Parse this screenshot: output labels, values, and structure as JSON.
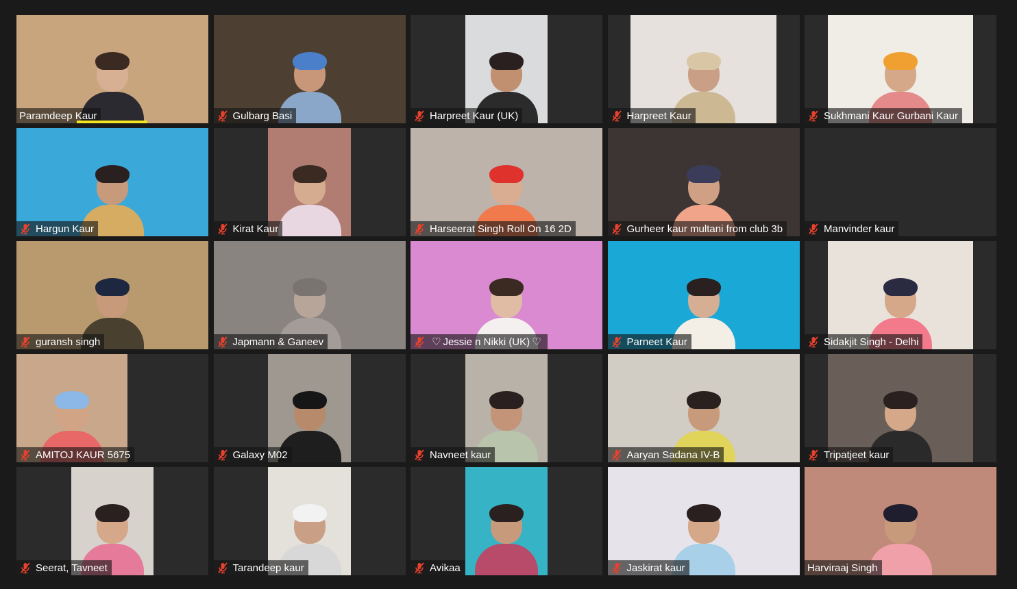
{
  "meeting": {
    "participants": [
      {
        "name": "Paramdeep Kaur",
        "muted": false,
        "speaking": true,
        "video_bg": "#c9a57d",
        "skin": "#d7b094",
        "wrap": "#3a2a22",
        "top": "#2b2a30"
      },
      {
        "name": "Gulbarg Basi",
        "muted": true,
        "speaking": false,
        "video_bg": "#4d4033",
        "skin": "#c8977a",
        "wrap": "#4b7fc9",
        "top": "#8aa6c8"
      },
      {
        "name": "Harpreet Kaur (UK)",
        "muted": true,
        "speaking": false,
        "video_bg": "#d9dbdc",
        "skin": "#c09070",
        "wrap": "#2a2020",
        "top": "#2b2b2b"
      },
      {
        "name": "Harpreet Kaur",
        "muted": true,
        "speaking": false,
        "video_bg": "#e6e1dc",
        "skin": "#c9a086",
        "wrap": "#d9c6a5",
        "top": "#cdb894"
      },
      {
        "name": "Sukhmani Kaur Gurbani Kaur",
        "muted": true,
        "speaking": false,
        "video_bg": "#f0ece6",
        "skin": "#d4a888",
        "wrap": "#f0a030",
        "top": "#e58a8a"
      },
      {
        "name": "Hargun Kaur",
        "muted": true,
        "speaking": false,
        "video_bg": "#3aa8d8",
        "skin": "#c89a7c",
        "wrap": "#2a2020",
        "top": "#d6ac62"
      },
      {
        "name": "Kirat Kaur",
        "muted": true,
        "speaking": false,
        "video_bg": "#b17d72",
        "skin": "#d6ac90",
        "wrap": "#3a2a22",
        "top": "#e8d6e0"
      },
      {
        "name": "Harseerat Singh Roll On 16 2D",
        "muted": true,
        "speaking": false,
        "video_bg": "#bdb3ab",
        "skin": "#d8ad92",
        "wrap": "#e0322c",
        "top": "#f07a4c"
      },
      {
        "name": "Gurheer kaur multani from club 3b",
        "muted": true,
        "speaking": false,
        "video_bg": "#3d3533",
        "skin": "#d0a085",
        "wrap": "#3a3c5a",
        "top": "#f0a48a"
      },
      {
        "name": "Manvinder kaur",
        "muted": true,
        "speaking": false,
        "video_bg": "#2b2b2b",
        "skin": "",
        "wrap": "",
        "top": ""
      },
      {
        "name": "guransh singh",
        "muted": true,
        "speaking": false,
        "video_bg": "#b89a6e",
        "skin": "#c89a7c",
        "wrap": "#1e2740",
        "top": "#4a4030"
      },
      {
        "name": "Japmann & Ganeev",
        "muted": true,
        "speaking": false,
        "video_bg": "#8a8480",
        "skin": "#b7a59a",
        "wrap": "#7a7470",
        "top": "#a39c98"
      },
      {
        "name": "Jessie n Nikki (UK)",
        "muted": true,
        "speaking": false,
        "video_bg": "#d98ad0",
        "skin": "#e0bca4",
        "wrap": "#3a2a22",
        "top": "#f5f0f0"
      },
      {
        "name": "Parneet Kaur",
        "muted": true,
        "speaking": false,
        "video_bg": "#1aa8d6",
        "skin": "#d6ae94",
        "wrap": "#2a2020",
        "top": "#f3efe6"
      },
      {
        "name": "Sidakjit Singh - Delhi",
        "muted": true,
        "speaking": false,
        "video_bg": "#e8e2da",
        "skin": "#d4a888",
        "wrap": "#2a2a40",
        "top": "#f27a8a"
      },
      {
        "name": "AMITOJ KAUR 5675",
        "muted": true,
        "speaking": false,
        "video_bg": "#c9a78a",
        "skin": "#d2a486",
        "wrap": "#8cb8e8",
        "top": "#e86868"
      },
      {
        "name": "Galaxy M02",
        "muted": true,
        "speaking": false,
        "video_bg": "#9e9890",
        "skin": "#b78a6c",
        "wrap": "#161616",
        "top": "#1e1e1e"
      },
      {
        "name": "Navneet kaur",
        "muted": true,
        "speaking": false,
        "video_bg": "#b8b2a8",
        "skin": "#c49478",
        "wrap": "#2a2020",
        "top": "#b8c4ac"
      },
      {
        "name": "Aaryan Sadana IV-B",
        "muted": true,
        "speaking": false,
        "video_bg": "#d2cdc4",
        "skin": "#c89a7c",
        "wrap": "#2a2020",
        "top": "#e0d45a"
      },
      {
        "name": "Tripatjeet kaur",
        "muted": true,
        "speaking": false,
        "video_bg": "#6a5e58",
        "skin": "#d4a888",
        "wrap": "#2a2020",
        "top": "#2a2a2a"
      },
      {
        "name": "Seerat, Tavneet",
        "muted": true,
        "speaking": false,
        "video_bg": "#d8d2cc",
        "skin": "#d4a888",
        "wrap": "#2a2020",
        "top": "#e57a9a"
      },
      {
        "name": "Tarandeep kaur",
        "muted": true,
        "speaking": false,
        "video_bg": "#e4e0da",
        "skin": "#c9a086",
        "wrap": "#f2f2f2",
        "top": "#d8d8d8"
      },
      {
        "name": "Avikaa",
        "muted": true,
        "speaking": false,
        "video_bg": "#36b3c4",
        "skin": "#c89a7c",
        "wrap": "#2a2020",
        "top": "#b84a6a"
      },
      {
        "name": "Jaskirat kaur",
        "muted": true,
        "speaking": false,
        "video_bg": "#e6e4ea",
        "skin": "#d4a888",
        "wrap": "#2a2020",
        "top": "#a8d0e8"
      },
      {
        "name": "Harviraaj Singh",
        "muted": false,
        "speaking": false,
        "video_bg": "#c08a7a",
        "skin": "#c89a7c",
        "wrap": "#1e1e2e",
        "top": "#f0a0a8"
      }
    ]
  },
  "theme": {
    "muted_icon_color": "#e8412c",
    "speaking_indicator_color": "#f5e51e",
    "window_bg": "#1a1a1a",
    "empty_tile_bg": "#2b2b2b"
  }
}
